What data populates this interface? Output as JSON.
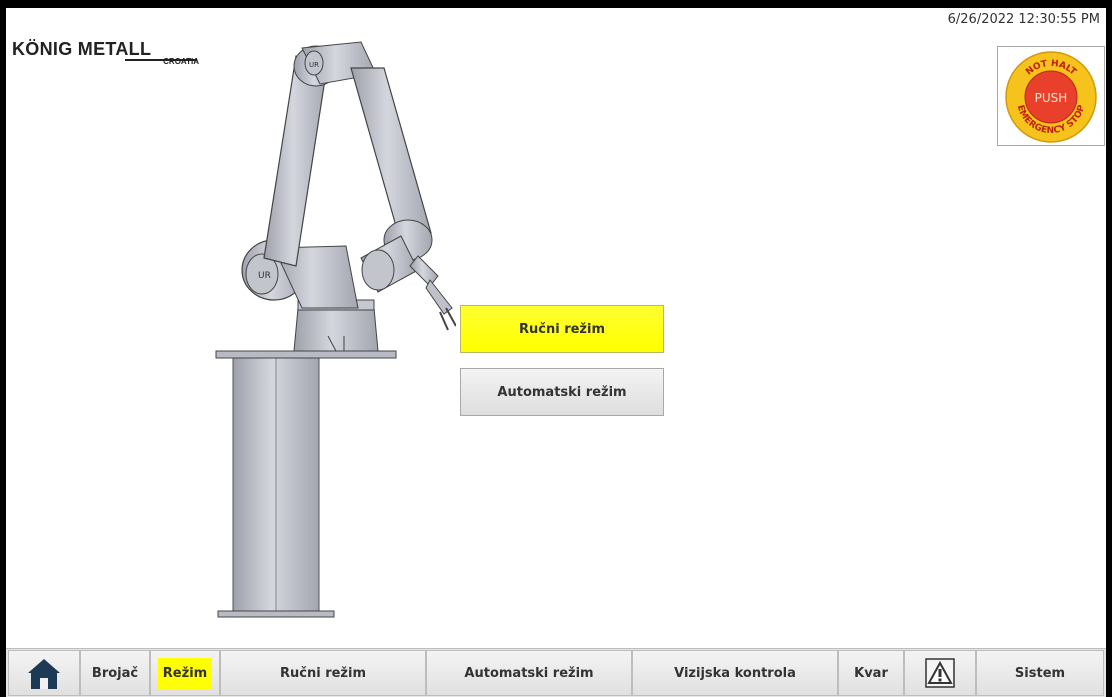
{
  "header": {
    "logo_text": "KÖNIG METALL",
    "logo_sub": "CROATIA",
    "datetime": "6/26/2022 12:30:55 PM"
  },
  "estop": {
    "top_text": "NOT HALT",
    "center_text": "PUSH",
    "bottom_text": "EMERGENCY STOP",
    "colors": {
      "button": "#e8402b",
      "ring": "#f6c21c",
      "panel_border": "#aaaaaa"
    }
  },
  "mode_buttons": {
    "manual_label": "Ručni režim",
    "auto_label": "Automatski režim",
    "active": "manual"
  },
  "nav": {
    "items": [
      {
        "id": "home",
        "label": "",
        "icon": "home-icon"
      },
      {
        "id": "brojac",
        "label": "Brojač"
      },
      {
        "id": "rezim",
        "label": "Režim",
        "active": true
      },
      {
        "id": "rucni",
        "label": "Ručni režim"
      },
      {
        "id": "automatski",
        "label": "Automatski režim"
      },
      {
        "id": "vizijska",
        "label": "Vizijska kontrola"
      },
      {
        "id": "kvar",
        "label": "Kvar"
      },
      {
        "id": "alarm",
        "label": "",
        "icon": "warning-icon"
      },
      {
        "id": "sistem",
        "label": "Sistem"
      }
    ]
  },
  "colors": {
    "active": "#ffff00",
    "button_bg": "#e8e8e8",
    "robot_body": "#c9cbd4"
  }
}
